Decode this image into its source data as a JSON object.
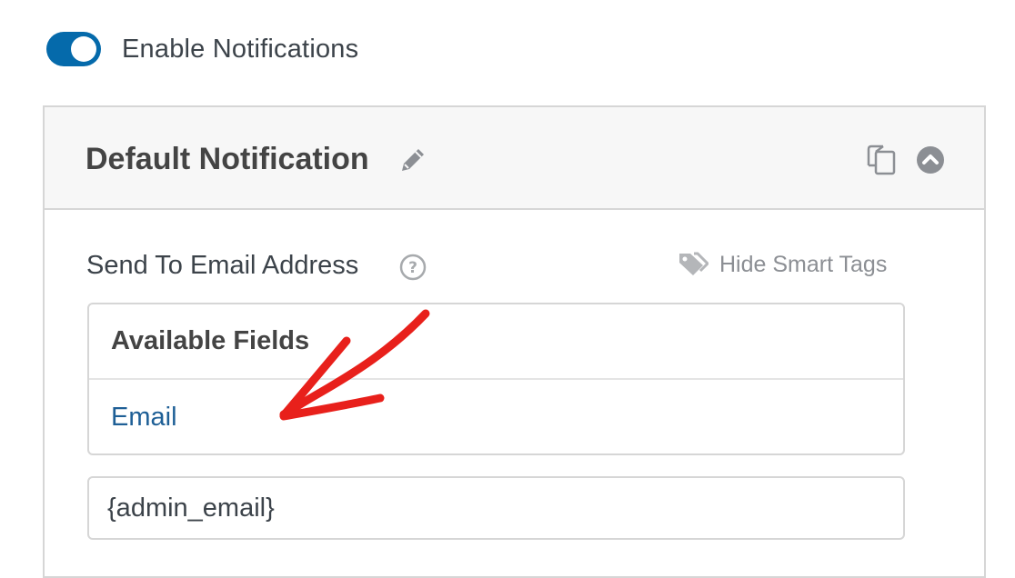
{
  "notifications": {
    "toggle_label": "Enable Notifications",
    "enabled": true
  },
  "panel": {
    "title": "Default Notification"
  },
  "send_to": {
    "label": "Send To Email Address",
    "smart_tags_label": "Hide Smart Tags",
    "available_fields_title": "Available Fields",
    "available_fields": [
      "Email"
    ],
    "value": "{admin_email}"
  },
  "icons": {
    "edit": "pencil-icon",
    "duplicate": "copy-icon",
    "collapse": "chevron-up-circle-icon",
    "help": "question-circle-icon",
    "smart_tags": "tag-icon"
  },
  "colors": {
    "toggle_on": "#056aab",
    "link": "#1e5f96",
    "annotation_arrow": "#e8201b",
    "muted": "#8c8f94"
  }
}
